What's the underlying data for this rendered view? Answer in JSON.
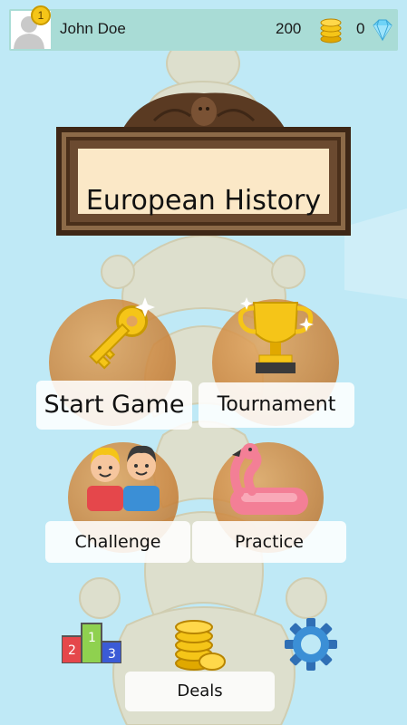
{
  "header": {
    "username": "John Doe",
    "level": "1",
    "coins": "200",
    "gems": "0"
  },
  "title": "European History",
  "modes": [
    {
      "label": "Start Game",
      "icon": "key-icon"
    },
    {
      "label": "Tournament",
      "icon": "trophy-icon"
    },
    {
      "label": "Challenge",
      "icon": "friends-icon"
    },
    {
      "label": "Practice",
      "icon": "flamingo-float-icon"
    }
  ],
  "bottom": {
    "leaderboard_icon": "podium-icon",
    "deals_label": "Deals",
    "deals_icon": "coin-stack-icon",
    "settings_icon": "gear-icon"
  },
  "colors": {
    "background": "#bfe9f6",
    "topbar": "#a9dcd6",
    "circle": "#c9823a",
    "frame": "#3e2716",
    "title_panel": "#fbe8c7"
  }
}
